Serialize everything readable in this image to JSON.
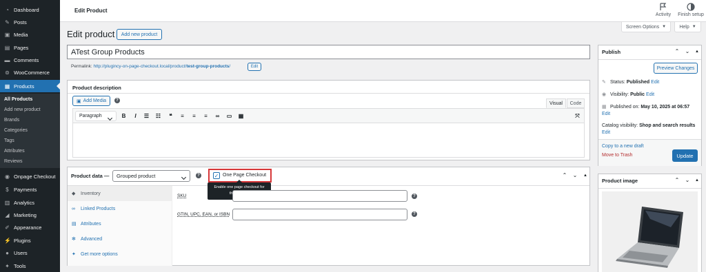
{
  "sidebar": {
    "items": [
      {
        "label": "Dashboard",
        "icon": "dashboard-icon"
      },
      {
        "label": "Posts",
        "icon": "pin-icon"
      },
      {
        "label": "Media",
        "icon": "media-icon"
      },
      {
        "label": "Pages",
        "icon": "pages-icon"
      },
      {
        "label": "Comments",
        "icon": "comment-icon"
      },
      {
        "label": "WooCommerce",
        "icon": "woo-icon"
      },
      {
        "label": "Products",
        "icon": "archive-icon"
      },
      {
        "label": "Onpage Checkout",
        "icon": "cart-icon"
      },
      {
        "label": "Payments",
        "icon": "dollar-icon"
      },
      {
        "label": "Analytics",
        "icon": "bar-chart-icon"
      },
      {
        "label": "Marketing",
        "icon": "megaphone-icon"
      },
      {
        "label": "Appearance",
        "icon": "brush-icon"
      },
      {
        "label": "Plugins",
        "icon": "plug-icon"
      },
      {
        "label": "Users",
        "icon": "user-icon"
      },
      {
        "label": "Tools",
        "icon": "wrench-icon"
      }
    ],
    "submenu": [
      "All Products",
      "Add new product",
      "Brands",
      "Categories",
      "Tags",
      "Attributes",
      "Reviews"
    ]
  },
  "topbar": {
    "title": "Edit Product",
    "activity": "Activity",
    "finish_setup": "Finish setup"
  },
  "screen_options": "Screen Options",
  "help": "Help",
  "page": {
    "title": "Edit product",
    "add_new": "Add new product",
    "product_title": "ATest Group Products",
    "permalink_label": "Permalink:",
    "permalink_base": "http://plugincy-on-page-checkout.local/product/",
    "permalink_slug": "test-group-products",
    "permalink_end": "/",
    "edit_btn": "Edit"
  },
  "description": {
    "heading": "Product description",
    "add_media": "Add Media",
    "tab_visual": "Visual",
    "tab_code": "Code",
    "paragraph": "Paragraph"
  },
  "product_data": {
    "heading": "Product data —",
    "type": "Grouped product",
    "opc_label": "One Page Checkout",
    "tooltip": "Enable one page checkout for this product",
    "tabs": [
      "Inventory",
      "Linked Products",
      "Attributes",
      "Advanced",
      "Get more options"
    ],
    "sku_label": "SKU",
    "gtin_label": "GTIN, UPC, EAN, or ISBN"
  },
  "publish": {
    "heading": "Publish",
    "preview": "Preview Changes",
    "status_label": "Status:",
    "status_value": "Published",
    "visibility_label": "Visibility:",
    "visibility_value": "Public",
    "published_label": "Published on:",
    "published_value": "May 10, 2025 at 06:57",
    "catalog_label": "Catalog visibility:",
    "catalog_value": "Shop and search results",
    "edit": "Edit",
    "copy_draft": "Copy to a new draft",
    "trash": "Move to Trash",
    "update": "Update"
  },
  "product_image": {
    "heading": "Product image"
  },
  "colors": {
    "accent": "#2271b1",
    "sidebar": "#1d2327",
    "trash": "#b32d2e",
    "highlight": "#d63638"
  }
}
